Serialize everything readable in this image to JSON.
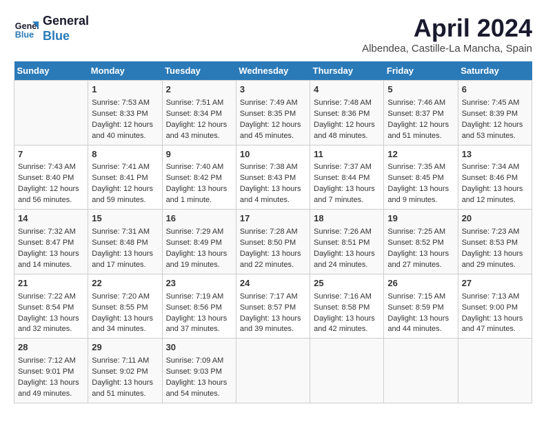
{
  "logo": {
    "line1": "General",
    "line2": "Blue"
  },
  "title": "April 2024",
  "subtitle": "Albendea, Castille-La Mancha, Spain",
  "days_of_week": [
    "Sunday",
    "Monday",
    "Tuesday",
    "Wednesday",
    "Thursday",
    "Friday",
    "Saturday"
  ],
  "weeks": [
    [
      {
        "day": "",
        "sunrise": "",
        "sunset": "",
        "daylight": ""
      },
      {
        "day": "1",
        "sunrise": "Sunrise: 7:53 AM",
        "sunset": "Sunset: 8:33 PM",
        "daylight": "Daylight: 12 hours and 40 minutes."
      },
      {
        "day": "2",
        "sunrise": "Sunrise: 7:51 AM",
        "sunset": "Sunset: 8:34 PM",
        "daylight": "Daylight: 12 hours and 43 minutes."
      },
      {
        "day": "3",
        "sunrise": "Sunrise: 7:49 AM",
        "sunset": "Sunset: 8:35 PM",
        "daylight": "Daylight: 12 hours and 45 minutes."
      },
      {
        "day": "4",
        "sunrise": "Sunrise: 7:48 AM",
        "sunset": "Sunset: 8:36 PM",
        "daylight": "Daylight: 12 hours and 48 minutes."
      },
      {
        "day": "5",
        "sunrise": "Sunrise: 7:46 AM",
        "sunset": "Sunset: 8:37 PM",
        "daylight": "Daylight: 12 hours and 51 minutes."
      },
      {
        "day": "6",
        "sunrise": "Sunrise: 7:45 AM",
        "sunset": "Sunset: 8:39 PM",
        "daylight": "Daylight: 12 hours and 53 minutes."
      }
    ],
    [
      {
        "day": "7",
        "sunrise": "Sunrise: 7:43 AM",
        "sunset": "Sunset: 8:40 PM",
        "daylight": "Daylight: 12 hours and 56 minutes."
      },
      {
        "day": "8",
        "sunrise": "Sunrise: 7:41 AM",
        "sunset": "Sunset: 8:41 PM",
        "daylight": "Daylight: 12 hours and 59 minutes."
      },
      {
        "day": "9",
        "sunrise": "Sunrise: 7:40 AM",
        "sunset": "Sunset: 8:42 PM",
        "daylight": "Daylight: 13 hours and 1 minute."
      },
      {
        "day": "10",
        "sunrise": "Sunrise: 7:38 AM",
        "sunset": "Sunset: 8:43 PM",
        "daylight": "Daylight: 13 hours and 4 minutes."
      },
      {
        "day": "11",
        "sunrise": "Sunrise: 7:37 AM",
        "sunset": "Sunset: 8:44 PM",
        "daylight": "Daylight: 13 hours and 7 minutes."
      },
      {
        "day": "12",
        "sunrise": "Sunrise: 7:35 AM",
        "sunset": "Sunset: 8:45 PM",
        "daylight": "Daylight: 13 hours and 9 minutes."
      },
      {
        "day": "13",
        "sunrise": "Sunrise: 7:34 AM",
        "sunset": "Sunset: 8:46 PM",
        "daylight": "Daylight: 13 hours and 12 minutes."
      }
    ],
    [
      {
        "day": "14",
        "sunrise": "Sunrise: 7:32 AM",
        "sunset": "Sunset: 8:47 PM",
        "daylight": "Daylight: 13 hours and 14 minutes."
      },
      {
        "day": "15",
        "sunrise": "Sunrise: 7:31 AM",
        "sunset": "Sunset: 8:48 PM",
        "daylight": "Daylight: 13 hours and 17 minutes."
      },
      {
        "day": "16",
        "sunrise": "Sunrise: 7:29 AM",
        "sunset": "Sunset: 8:49 PM",
        "daylight": "Daylight: 13 hours and 19 minutes."
      },
      {
        "day": "17",
        "sunrise": "Sunrise: 7:28 AM",
        "sunset": "Sunset: 8:50 PM",
        "daylight": "Daylight: 13 hours and 22 minutes."
      },
      {
        "day": "18",
        "sunrise": "Sunrise: 7:26 AM",
        "sunset": "Sunset: 8:51 PM",
        "daylight": "Daylight: 13 hours and 24 minutes."
      },
      {
        "day": "19",
        "sunrise": "Sunrise: 7:25 AM",
        "sunset": "Sunset: 8:52 PM",
        "daylight": "Daylight: 13 hours and 27 minutes."
      },
      {
        "day": "20",
        "sunrise": "Sunrise: 7:23 AM",
        "sunset": "Sunset: 8:53 PM",
        "daylight": "Daylight: 13 hours and 29 minutes."
      }
    ],
    [
      {
        "day": "21",
        "sunrise": "Sunrise: 7:22 AM",
        "sunset": "Sunset: 8:54 PM",
        "daylight": "Daylight: 13 hours and 32 minutes."
      },
      {
        "day": "22",
        "sunrise": "Sunrise: 7:20 AM",
        "sunset": "Sunset: 8:55 PM",
        "daylight": "Daylight: 13 hours and 34 minutes."
      },
      {
        "day": "23",
        "sunrise": "Sunrise: 7:19 AM",
        "sunset": "Sunset: 8:56 PM",
        "daylight": "Daylight: 13 hours and 37 minutes."
      },
      {
        "day": "24",
        "sunrise": "Sunrise: 7:17 AM",
        "sunset": "Sunset: 8:57 PM",
        "daylight": "Daylight: 13 hours and 39 minutes."
      },
      {
        "day": "25",
        "sunrise": "Sunrise: 7:16 AM",
        "sunset": "Sunset: 8:58 PM",
        "daylight": "Daylight: 13 hours and 42 minutes."
      },
      {
        "day": "26",
        "sunrise": "Sunrise: 7:15 AM",
        "sunset": "Sunset: 8:59 PM",
        "daylight": "Daylight: 13 hours and 44 minutes."
      },
      {
        "day": "27",
        "sunrise": "Sunrise: 7:13 AM",
        "sunset": "Sunset: 9:00 PM",
        "daylight": "Daylight: 13 hours and 47 minutes."
      }
    ],
    [
      {
        "day": "28",
        "sunrise": "Sunrise: 7:12 AM",
        "sunset": "Sunset: 9:01 PM",
        "daylight": "Daylight: 13 hours and 49 minutes."
      },
      {
        "day": "29",
        "sunrise": "Sunrise: 7:11 AM",
        "sunset": "Sunset: 9:02 PM",
        "daylight": "Daylight: 13 hours and 51 minutes."
      },
      {
        "day": "30",
        "sunrise": "Sunrise: 7:09 AM",
        "sunset": "Sunset: 9:03 PM",
        "daylight": "Daylight: 13 hours and 54 minutes."
      },
      {
        "day": "",
        "sunrise": "",
        "sunset": "",
        "daylight": ""
      },
      {
        "day": "",
        "sunrise": "",
        "sunset": "",
        "daylight": ""
      },
      {
        "day": "",
        "sunrise": "",
        "sunset": "",
        "daylight": ""
      },
      {
        "day": "",
        "sunrise": "",
        "sunset": "",
        "daylight": ""
      }
    ]
  ]
}
